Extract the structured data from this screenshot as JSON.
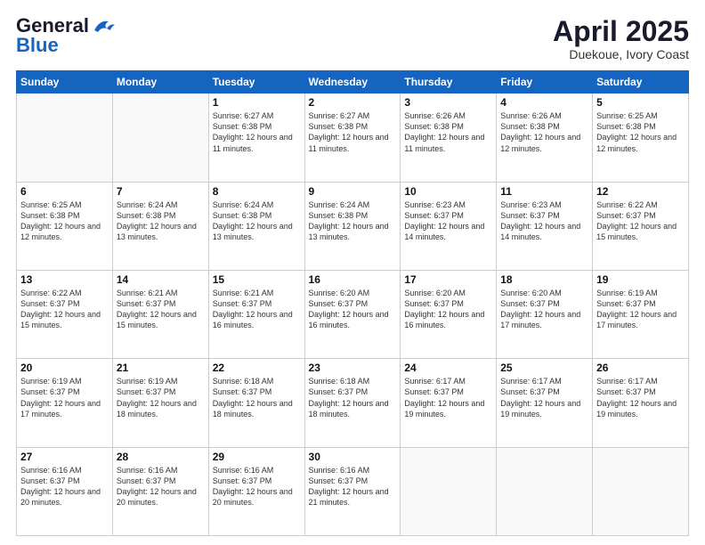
{
  "header": {
    "logo_general": "General",
    "logo_blue": "Blue",
    "title": "April 2025",
    "subtitle": "Duekoue, Ivory Coast"
  },
  "days_of_week": [
    "Sunday",
    "Monday",
    "Tuesday",
    "Wednesday",
    "Thursday",
    "Friday",
    "Saturday"
  ],
  "weeks": [
    [
      {
        "day": "",
        "info": ""
      },
      {
        "day": "",
        "info": ""
      },
      {
        "day": "1",
        "info": "Sunrise: 6:27 AM\nSunset: 6:38 PM\nDaylight: 12 hours and 11 minutes."
      },
      {
        "day": "2",
        "info": "Sunrise: 6:27 AM\nSunset: 6:38 PM\nDaylight: 12 hours and 11 minutes."
      },
      {
        "day": "3",
        "info": "Sunrise: 6:26 AM\nSunset: 6:38 PM\nDaylight: 12 hours and 11 minutes."
      },
      {
        "day": "4",
        "info": "Sunrise: 6:26 AM\nSunset: 6:38 PM\nDaylight: 12 hours and 12 minutes."
      },
      {
        "day": "5",
        "info": "Sunrise: 6:25 AM\nSunset: 6:38 PM\nDaylight: 12 hours and 12 minutes."
      }
    ],
    [
      {
        "day": "6",
        "info": "Sunrise: 6:25 AM\nSunset: 6:38 PM\nDaylight: 12 hours and 12 minutes."
      },
      {
        "day": "7",
        "info": "Sunrise: 6:24 AM\nSunset: 6:38 PM\nDaylight: 12 hours and 13 minutes."
      },
      {
        "day": "8",
        "info": "Sunrise: 6:24 AM\nSunset: 6:38 PM\nDaylight: 12 hours and 13 minutes."
      },
      {
        "day": "9",
        "info": "Sunrise: 6:24 AM\nSunset: 6:38 PM\nDaylight: 12 hours and 13 minutes."
      },
      {
        "day": "10",
        "info": "Sunrise: 6:23 AM\nSunset: 6:37 PM\nDaylight: 12 hours and 14 minutes."
      },
      {
        "day": "11",
        "info": "Sunrise: 6:23 AM\nSunset: 6:37 PM\nDaylight: 12 hours and 14 minutes."
      },
      {
        "day": "12",
        "info": "Sunrise: 6:22 AM\nSunset: 6:37 PM\nDaylight: 12 hours and 15 minutes."
      }
    ],
    [
      {
        "day": "13",
        "info": "Sunrise: 6:22 AM\nSunset: 6:37 PM\nDaylight: 12 hours and 15 minutes."
      },
      {
        "day": "14",
        "info": "Sunrise: 6:21 AM\nSunset: 6:37 PM\nDaylight: 12 hours and 15 minutes."
      },
      {
        "day": "15",
        "info": "Sunrise: 6:21 AM\nSunset: 6:37 PM\nDaylight: 12 hours and 16 minutes."
      },
      {
        "day": "16",
        "info": "Sunrise: 6:20 AM\nSunset: 6:37 PM\nDaylight: 12 hours and 16 minutes."
      },
      {
        "day": "17",
        "info": "Sunrise: 6:20 AM\nSunset: 6:37 PM\nDaylight: 12 hours and 16 minutes."
      },
      {
        "day": "18",
        "info": "Sunrise: 6:20 AM\nSunset: 6:37 PM\nDaylight: 12 hours and 17 minutes."
      },
      {
        "day": "19",
        "info": "Sunrise: 6:19 AM\nSunset: 6:37 PM\nDaylight: 12 hours and 17 minutes."
      }
    ],
    [
      {
        "day": "20",
        "info": "Sunrise: 6:19 AM\nSunset: 6:37 PM\nDaylight: 12 hours and 17 minutes."
      },
      {
        "day": "21",
        "info": "Sunrise: 6:19 AM\nSunset: 6:37 PM\nDaylight: 12 hours and 18 minutes."
      },
      {
        "day": "22",
        "info": "Sunrise: 6:18 AM\nSunset: 6:37 PM\nDaylight: 12 hours and 18 minutes."
      },
      {
        "day": "23",
        "info": "Sunrise: 6:18 AM\nSunset: 6:37 PM\nDaylight: 12 hours and 18 minutes."
      },
      {
        "day": "24",
        "info": "Sunrise: 6:17 AM\nSunset: 6:37 PM\nDaylight: 12 hours and 19 minutes."
      },
      {
        "day": "25",
        "info": "Sunrise: 6:17 AM\nSunset: 6:37 PM\nDaylight: 12 hours and 19 minutes."
      },
      {
        "day": "26",
        "info": "Sunrise: 6:17 AM\nSunset: 6:37 PM\nDaylight: 12 hours and 19 minutes."
      }
    ],
    [
      {
        "day": "27",
        "info": "Sunrise: 6:16 AM\nSunset: 6:37 PM\nDaylight: 12 hours and 20 minutes."
      },
      {
        "day": "28",
        "info": "Sunrise: 6:16 AM\nSunset: 6:37 PM\nDaylight: 12 hours and 20 minutes."
      },
      {
        "day": "29",
        "info": "Sunrise: 6:16 AM\nSunset: 6:37 PM\nDaylight: 12 hours and 20 minutes."
      },
      {
        "day": "30",
        "info": "Sunrise: 6:16 AM\nSunset: 6:37 PM\nDaylight: 12 hours and 21 minutes."
      },
      {
        "day": "",
        "info": ""
      },
      {
        "day": "",
        "info": ""
      },
      {
        "day": "",
        "info": ""
      }
    ]
  ]
}
